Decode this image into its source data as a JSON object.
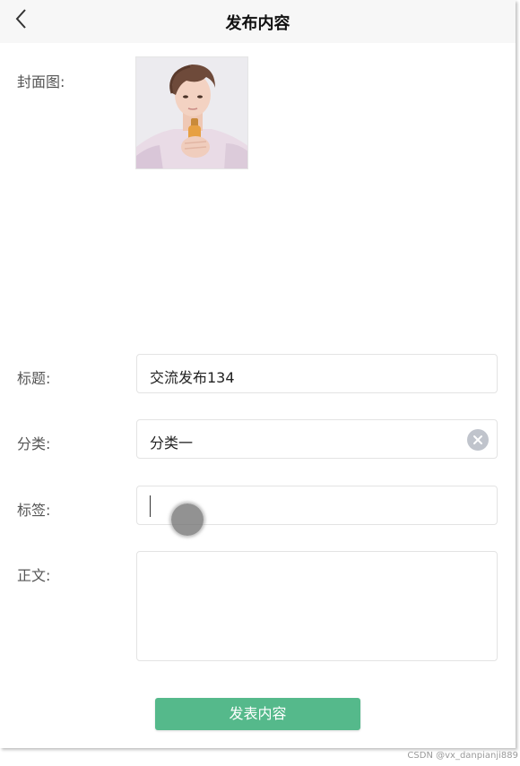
{
  "header": {
    "title": "发布内容"
  },
  "form": {
    "cover_label": "封面图:",
    "title_label": "标题:",
    "title_value": "交流发布134",
    "category_label": "分类:",
    "category_value": "分类一",
    "tags_label": "标签:",
    "tags_value": "",
    "body_label": "正文:",
    "body_value": ""
  },
  "submit": {
    "label": "发表内容"
  },
  "watermark": "CSDN @vx_danpianji889",
  "colors": {
    "accent": "#55b98b",
    "header_bg": "#f7f7f7"
  }
}
